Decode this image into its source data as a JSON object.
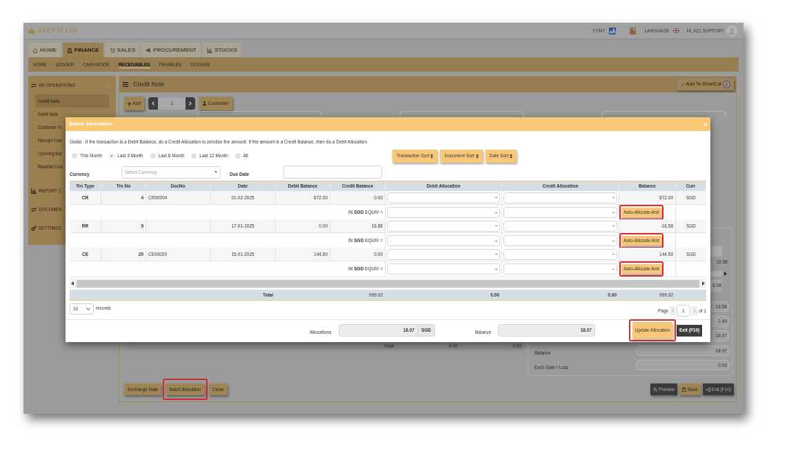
{
  "header": {
    "company": "XYZ PTE LTD",
    "font_label": "FONT",
    "language_label": "LANGUAGE",
    "greeting": "HI, A21 SUPPORT"
  },
  "modules": [
    {
      "label": "HOME",
      "selected": false
    },
    {
      "label": "FINANCE",
      "selected": true
    },
    {
      "label": "SALES",
      "selected": false
    },
    {
      "label": "PROCUREMENT",
      "selected": false
    },
    {
      "label": "STOCKS",
      "selected": false
    }
  ],
  "subnav": [
    {
      "label": "HOME",
      "selected": false
    },
    {
      "label": "LEDGER",
      "selected": false
    },
    {
      "label": "CASH BOOK",
      "selected": false
    },
    {
      "label": "RECEIVABLES",
      "selected": true
    },
    {
      "label": "PAYABLES",
      "selected": false
    },
    {
      "label": "DOCHUB",
      "selected": false
    }
  ],
  "sidebar": [
    {
      "label": "AR OPERATIONS",
      "expanded": true,
      "children": [
        {
          "label": "Credit Note",
          "selected": true
        },
        {
          "label": "Debit Note",
          "selected": false
        },
        {
          "label": "Customer In",
          "selected": false
        },
        {
          "label": "Receipt Tran",
          "selected": false
        },
        {
          "label": "Opening Bal",
          "selected": false
        },
        {
          "label": "Blacklist Cus",
          "selected": false
        }
      ]
    },
    {
      "label": "REPORT C",
      "expanded": false
    },
    {
      "label": "DOCUMEN",
      "expanded": false
    },
    {
      "label": "SETTINGS",
      "expanded": false
    }
  ],
  "page": {
    "title": "Credit Note",
    "shortcut_button": "Add To ShortCut",
    "shortcut_count": "0",
    "toolbar": {
      "add_button": "Add",
      "record_number": "1",
      "customer_button": "Customer"
    },
    "summary": {
      "total_label": "Total",
      "total_values": [
        "0.00",
        "0.00"
      ],
      "partial_table": {
        "cell": "16.58",
        "total_cell": "6.58"
      },
      "partial_fields": [
        "16.58",
        "1.49",
        "18.07"
      ],
      "fields": [
        {
          "label": "Balance",
          "value": "18.07"
        },
        {
          "label": "Exch Gain / Loss",
          "value": "0.00"
        }
      ]
    },
    "left_buttons": [
      {
        "label": "Exchange Rate",
        "highlighted": false
      },
      {
        "label": "Batch Allocation",
        "highlighted": true
      },
      {
        "label": "Clone",
        "highlighted": false
      }
    ],
    "right_buttons": [
      {
        "label": "Preview",
        "kind": "dark"
      },
      {
        "label": "Save",
        "kind": "gold"
      },
      {
        "label": "Exit (F10)",
        "kind": "dark"
      }
    ]
  },
  "dialog": {
    "title": "Batch Allocation",
    "guide": "Guide : If the transaction is a Debit Balance, do a Credit Allocation to zerolize the amount. If the amount is a Credit Balance, then do a Debit Allocation.",
    "periods": [
      {
        "label": "This Month",
        "selected": false
      },
      {
        "label": "Last 3 Month",
        "selected": true
      },
      {
        "label": "Last 6 Month",
        "selected": false
      },
      {
        "label": "Last 12 Month",
        "selected": false
      },
      {
        "label": "All",
        "selected": false
      }
    ],
    "sort_buttons": [
      "Transaction Sort",
      "Document Sort",
      "Date Sort"
    ],
    "currency": {
      "label": "Currency",
      "placeholder": "Select Currency"
    },
    "due_date": {
      "label": "Due Date"
    },
    "columns": [
      "Trn Type",
      "Trn No",
      "DocNo",
      "Date",
      "Debit Balance",
      "Credit Balance",
      "Debit Allocation",
      "Credit Allocation",
      "Balance",
      "Curr"
    ],
    "rows": [
      {
        "trn_type": "CR",
        "trn_no": "4",
        "doc_no": "CR00004",
        "date": "01-02-2025",
        "debit_balance": "872.00",
        "credit_balance": "0.00",
        "balance": "872.00",
        "curr": "SGD",
        "equiv_label": "IN **SGD** EQUIV =",
        "action": "Auto-Allocate Amt",
        "highlighted": true
      },
      {
        "trn_type": "RR",
        "trn_no": "9",
        "date": "17-01-2025",
        "debit_balance": "0.00",
        "credit_balance": "16.58",
        "balance": "-16.58",
        "curr": "SGD",
        "equiv_label": "IN **SGD** EQUIV =",
        "action": "Auto-Allocate Amt",
        "highlighted": true
      },
      {
        "trn_type": "CE",
        "trn_no": "20",
        "doc_no": "CE00020",
        "date": "15-01-2025",
        "debit_balance": "144.50",
        "credit_balance": "0.00",
        "balance": "144.50",
        "curr": "SGD",
        "equiv_label": "IN **SGD** EQUIV =",
        "action": "Auto-Allocate Amt",
        "highlighted": true
      }
    ],
    "total": {
      "label": "Total",
      "credit_balance": "999.92",
      "debit_allocation": "0.00",
      "credit_allocation": "0.00",
      "balance": "999.92"
    },
    "page_size": "10",
    "records_label": "records",
    "pager": {
      "page_label": "Page",
      "page": "1",
      "of_label": "of 1"
    },
    "allocations": {
      "label": "Allocations",
      "value": "18.07",
      "currency": "SGD"
    },
    "balance": {
      "label": "Balance",
      "value": "18.07"
    },
    "buttons": [
      {
        "label": "Update Allocation",
        "kind": "primary",
        "highlighted": true
      },
      {
        "label": "Exit (F10)",
        "kind": "dark",
        "highlighted": false
      }
    ]
  }
}
